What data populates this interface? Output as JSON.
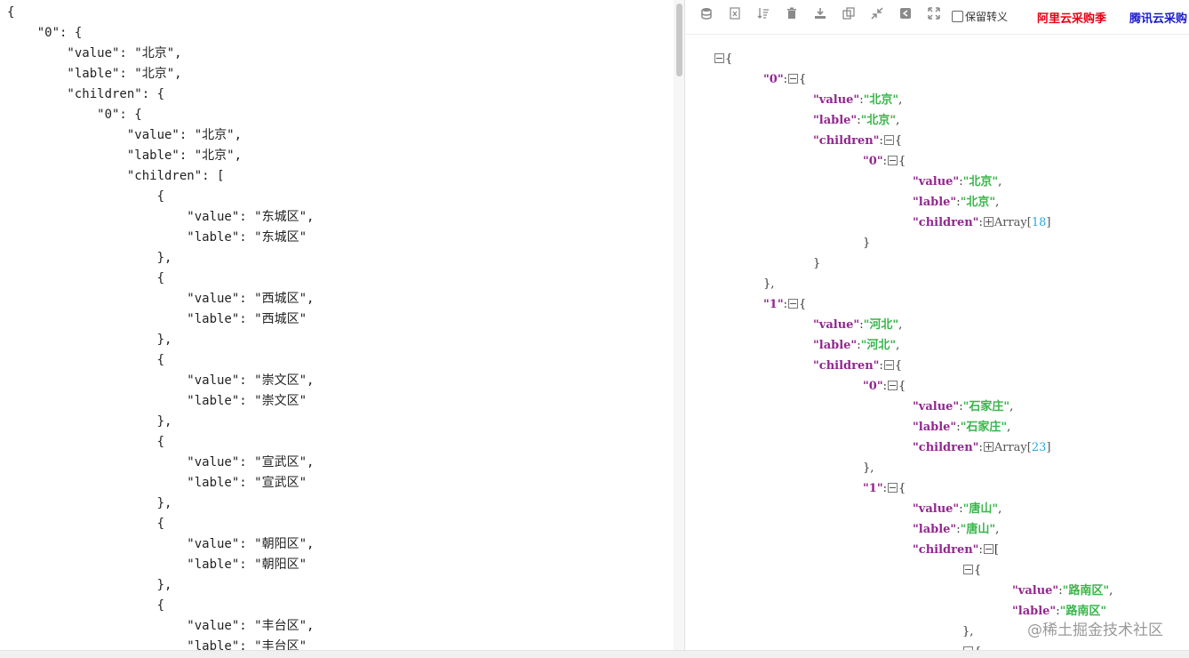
{
  "editor": {
    "lines": [
      "{",
      "    \"0\": {",
      "        \"value\": \"北京\",",
      "        \"lable\": \"北京\",",
      "        \"children\": {",
      "            \"0\": {",
      "                \"value\": \"北京\",",
      "                \"lable\": \"北京\",",
      "                \"children\": [",
      "                    {",
      "                        \"value\": \"东城区\",",
      "                        \"lable\": \"东城区\"",
      "                    },",
      "                    {",
      "                        \"value\": \"西城区\",",
      "                        \"lable\": \"西城区\"",
      "                    },",
      "                    {",
      "                        \"value\": \"崇文区\",",
      "                        \"lable\": \"崇文区\"",
      "                    },",
      "                    {",
      "                        \"value\": \"宣武区\",",
      "                        \"lable\": \"宣武区\"",
      "                    },",
      "                    {",
      "                        \"value\": \"朝阳区\",",
      "                        \"lable\": \"朝阳区\"",
      "                    },",
      "                    {",
      "                        \"value\": \"丰台区\",",
      "                        \"lable\": \"丰台区\""
    ]
  },
  "toolbar": {
    "icons": [
      "database-icon",
      "excel-icon",
      "sort-icon",
      "delete-icon",
      "download-icon",
      "copy-icon",
      "compress-icon",
      "share-icon",
      "expand-icon"
    ],
    "keep_escape_label": "保留转义",
    "keep_escape_checked": false,
    "aliyun_link": "阿里云采购季",
    "aliyun_color": "#e60012",
    "tencent_link": "腾讯云采购",
    "tencent_color": "#1a1acd"
  },
  "tree": {
    "colors": {
      "key": "#92278f",
      "string": "#3ab54a",
      "number": "#25aae2"
    },
    "lines": [
      {
        "indent": 0,
        "tog": "minus",
        "parts": [
          [
            "p",
            "{"
          ]
        ]
      },
      {
        "indent": 1,
        "parts": [
          [
            "k",
            "\"0\""
          ],
          [
            "p",
            ":"
          ],
          [
            "t",
            "minus"
          ],
          [
            "p",
            "{"
          ]
        ]
      },
      {
        "indent": 2,
        "parts": [
          [
            "k",
            "\"value\""
          ],
          [
            "p",
            ":"
          ],
          [
            "s",
            "\"北京\""
          ],
          [
            "p",
            ","
          ]
        ]
      },
      {
        "indent": 2,
        "parts": [
          [
            "k",
            "\"lable\""
          ],
          [
            "p",
            ":"
          ],
          [
            "s",
            "\"北京\""
          ],
          [
            "p",
            ","
          ]
        ]
      },
      {
        "indent": 2,
        "parts": [
          [
            "k",
            "\"children\""
          ],
          [
            "p",
            ":"
          ],
          [
            "t",
            "minus"
          ],
          [
            "p",
            "{"
          ]
        ]
      },
      {
        "indent": 3,
        "parts": [
          [
            "k",
            "\"0\""
          ],
          [
            "p",
            ":"
          ],
          [
            "t",
            "minus"
          ],
          [
            "p",
            "{"
          ]
        ]
      },
      {
        "indent": 4,
        "parts": [
          [
            "k",
            "\"value\""
          ],
          [
            "p",
            ":"
          ],
          [
            "s",
            "\"北京\""
          ],
          [
            "p",
            ","
          ]
        ]
      },
      {
        "indent": 4,
        "parts": [
          [
            "k",
            "\"lable\""
          ],
          [
            "p",
            ":"
          ],
          [
            "s",
            "\"北京\""
          ],
          [
            "p",
            ","
          ]
        ]
      },
      {
        "indent": 4,
        "parts": [
          [
            "k",
            "\"children\""
          ],
          [
            "p",
            ":"
          ],
          [
            "t",
            "plus"
          ],
          [
            "a",
            "Array["
          ],
          [
            "n",
            "18"
          ],
          [
            "a",
            "]"
          ]
        ]
      },
      {
        "indent": 3,
        "parts": [
          [
            "p",
            "}"
          ]
        ]
      },
      {
        "indent": 2,
        "parts": [
          [
            "p",
            "}"
          ]
        ]
      },
      {
        "indent": 1,
        "parts": [
          [
            "p",
            "},"
          ]
        ]
      },
      {
        "indent": 1,
        "parts": [
          [
            "k",
            "\"1\""
          ],
          [
            "p",
            ":"
          ],
          [
            "t",
            "minus"
          ],
          [
            "p",
            "{"
          ]
        ]
      },
      {
        "indent": 2,
        "parts": [
          [
            "k",
            "\"value\""
          ],
          [
            "p",
            ":"
          ],
          [
            "s",
            "\"河北\""
          ],
          [
            "p",
            ","
          ]
        ]
      },
      {
        "indent": 2,
        "parts": [
          [
            "k",
            "\"lable\""
          ],
          [
            "p",
            ":"
          ],
          [
            "s",
            "\"河北\""
          ],
          [
            "p",
            ","
          ]
        ]
      },
      {
        "indent": 2,
        "parts": [
          [
            "k",
            "\"children\""
          ],
          [
            "p",
            ":"
          ],
          [
            "t",
            "minus"
          ],
          [
            "p",
            "{"
          ]
        ]
      },
      {
        "indent": 3,
        "parts": [
          [
            "k",
            "\"0\""
          ],
          [
            "p",
            ":"
          ],
          [
            "t",
            "minus"
          ],
          [
            "p",
            "{"
          ]
        ]
      },
      {
        "indent": 4,
        "parts": [
          [
            "k",
            "\"value\""
          ],
          [
            "p",
            ":"
          ],
          [
            "s",
            "\"石家庄\""
          ],
          [
            "p",
            ","
          ]
        ]
      },
      {
        "indent": 4,
        "parts": [
          [
            "k",
            "\"lable\""
          ],
          [
            "p",
            ":"
          ],
          [
            "s",
            "\"石家庄\""
          ],
          [
            "p",
            ","
          ]
        ]
      },
      {
        "indent": 4,
        "parts": [
          [
            "k",
            "\"children\""
          ],
          [
            "p",
            ":"
          ],
          [
            "t",
            "plus"
          ],
          [
            "a",
            "Array["
          ],
          [
            "n",
            "23"
          ],
          [
            "a",
            "]"
          ]
        ]
      },
      {
        "indent": 3,
        "parts": [
          [
            "p",
            "},"
          ]
        ]
      },
      {
        "indent": 3,
        "parts": [
          [
            "k",
            "\"1\""
          ],
          [
            "p",
            ":"
          ],
          [
            "t",
            "minus"
          ],
          [
            "p",
            "{"
          ]
        ]
      },
      {
        "indent": 4,
        "parts": [
          [
            "k",
            "\"value\""
          ],
          [
            "p",
            ":"
          ],
          [
            "s",
            "\"唐山\""
          ],
          [
            "p",
            ","
          ]
        ]
      },
      {
        "indent": 4,
        "parts": [
          [
            "k",
            "\"lable\""
          ],
          [
            "p",
            ":"
          ],
          [
            "s",
            "\"唐山\""
          ],
          [
            "p",
            ","
          ]
        ]
      },
      {
        "indent": 4,
        "parts": [
          [
            "k",
            "\"children\""
          ],
          [
            "p",
            ":"
          ],
          [
            "t",
            "minus"
          ],
          [
            "p",
            "["
          ]
        ]
      },
      {
        "indent": 5,
        "parts": [
          [
            "t",
            "minus"
          ],
          [
            "p",
            "{"
          ]
        ]
      },
      {
        "indent": 6,
        "parts": [
          [
            "k",
            "\"value\""
          ],
          [
            "p",
            ":"
          ],
          [
            "s",
            "\"路南区\""
          ],
          [
            "p",
            ","
          ]
        ]
      },
      {
        "indent": 6,
        "parts": [
          [
            "k",
            "\"lable\""
          ],
          [
            "p",
            ":"
          ],
          [
            "s",
            "\"路南区\""
          ]
        ]
      },
      {
        "indent": 5,
        "parts": [
          [
            "p",
            "},"
          ]
        ]
      },
      {
        "indent": 5,
        "parts": [
          [
            "t",
            "minus"
          ],
          [
            "p",
            "{"
          ]
        ]
      }
    ]
  },
  "watermark": "@稀土掘金技术社区"
}
